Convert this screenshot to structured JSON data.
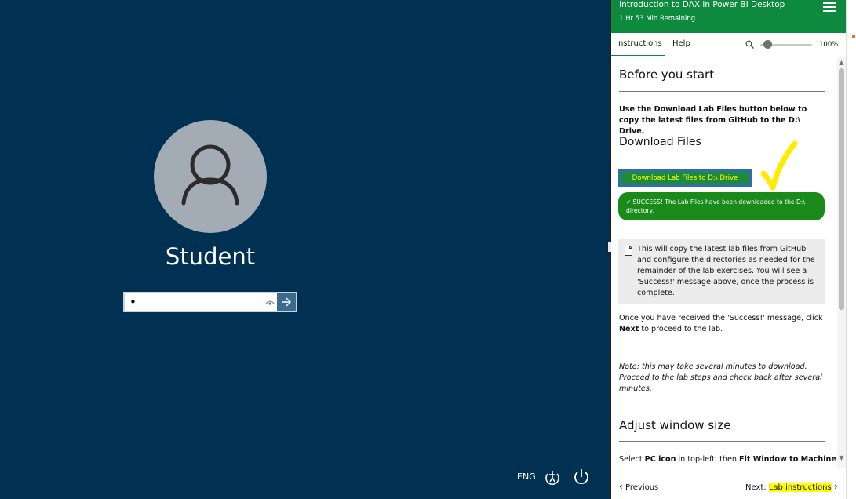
{
  "login": {
    "username": "Student",
    "password_value": "•",
    "language": "ENG"
  },
  "panel": {
    "lab_title": "Introduction to DAX in Power BI Desktop",
    "time_remaining": "1 Hr 53 Min Remaining",
    "tabs": [
      {
        "label": "Instructions"
      },
      {
        "label": "Help"
      }
    ],
    "zoom_level": "100%",
    "zoom_fraction": 0.15,
    "sections": {
      "before_start_title": "Before you start",
      "intro_text": "Use the Download Lab Files button below to copy the latest files from GitHub to the D:\\ Drive.",
      "download_title": "Download Files",
      "download_button": "Download Lab Files to D:\\ Drive",
      "success_message": "SUCCESS! The Lab Files have been downloaded to the D:\\ directory.",
      "note_text": "This will copy the latest lab files from GitHub and configure the directories as needed for the remainder of the lab exercises. You will see a 'Success!' message above, once the process is complete.",
      "next_text_before": "Once you have received the 'Success!' message, click ",
      "next_text_bold": "Next",
      "next_text_after": " to proceed to the lab.",
      "italic_note": "Note: this may take several minutes to download. Proceed to the lab steps and check back after several minutes.",
      "adjust_title": "Adjust window size",
      "select_pc_prefix": "Select ",
      "select_pc_bold1": "PC icon",
      "select_pc_mid": " in top-left, then ",
      "select_pc_bold2": "Fit Window to Machine"
    },
    "footer": {
      "previous_label": "Previous",
      "next_prefix": "Next:",
      "next_label": "Lab instructions"
    }
  },
  "colors": {
    "login_bg": "#003152",
    "header_green": "#0e8a3e",
    "success_green": "#1a8a1a",
    "highlight_yellow": "#ffff00"
  }
}
